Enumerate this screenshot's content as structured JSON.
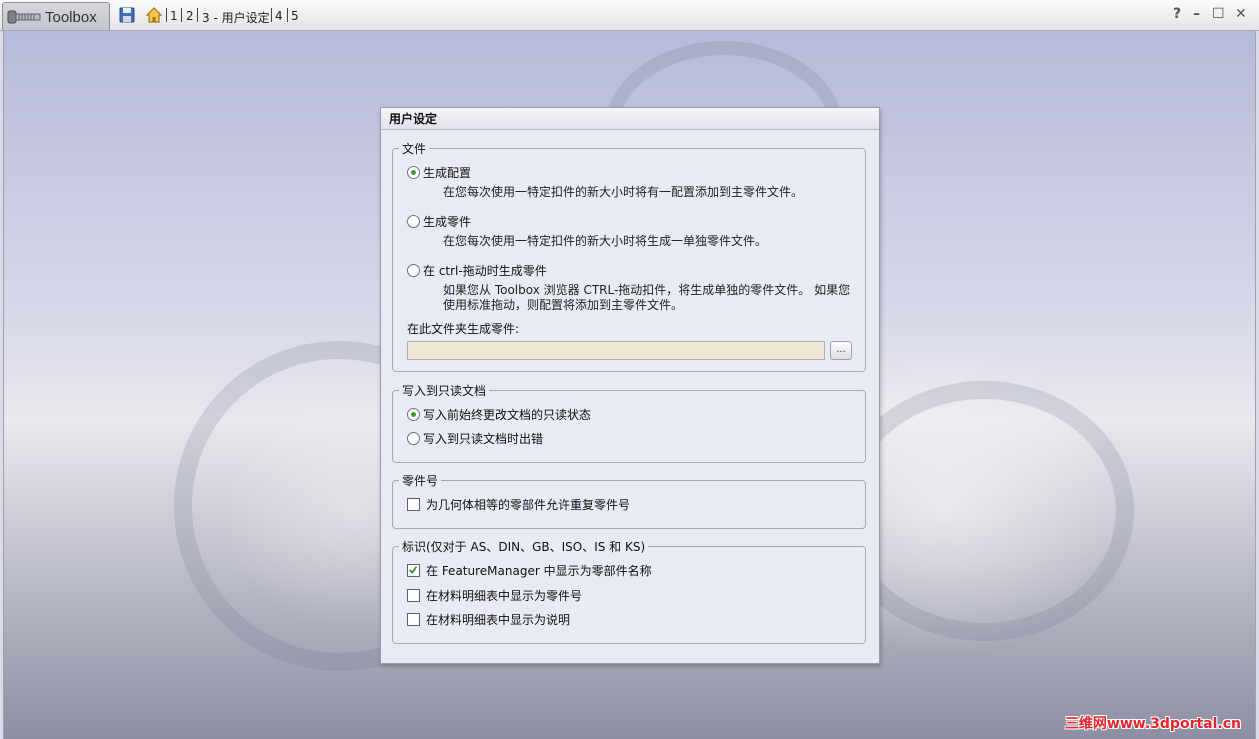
{
  "app": {
    "title": "Toolbox"
  },
  "breadcrumb": {
    "items": [
      "1",
      "2",
      "3 - 用户设定",
      "4",
      "5"
    ]
  },
  "window_controls": {
    "help": "?",
    "minimize": "–",
    "maximize": "☐",
    "close": "✕"
  },
  "dialog": {
    "title": "用户设定",
    "file_group": {
      "title": "文件",
      "options": [
        {
          "label": "生成配置",
          "selected": true,
          "desc": "在您每次使用一特定扣件的新大小时将有一配置添加到主零件文件。"
        },
        {
          "label": "生成零件",
          "selected": false,
          "desc": "在您每次使用一特定扣件的新大小时将生成一单独零件文件。"
        },
        {
          "label": "在 ctrl-拖动时生成零件",
          "selected": false,
          "desc": "如果您从 Toolbox 浏览器 CTRL-拖动扣件，将生成单独的零件文件。 如果您使用标准拖动，则配置将添加到主零件文件。"
        }
      ],
      "folder_label": "在此文件夹生成零件:",
      "folder_value": "",
      "browse_label": "..."
    },
    "readonly_group": {
      "title": "写入到只读文档",
      "options": [
        {
          "label": "写入前始终更改文档的只读状态",
          "selected": true
        },
        {
          "label": "写入到只读文档时出错",
          "selected": false
        }
      ]
    },
    "partnum_group": {
      "title": "零件号",
      "options": [
        {
          "label": "为几何体相等的零部件允许重复零件号",
          "checked": false
        }
      ]
    },
    "mark_group": {
      "title": "标识(仅对于 AS、DIN、GB、ISO、IS 和 KS)",
      "options": [
        {
          "label": "在 FeatureManager 中显示为零部件名称",
          "checked": true
        },
        {
          "label": "在材料明细表中显示为零件号",
          "checked": false
        },
        {
          "label": "在材料明细表中显示为说明",
          "checked": false
        }
      ]
    }
  },
  "watermark": {
    "text": "三维网www.3dportal.cn"
  },
  "colors": {
    "radio_dot": "#3a9b3a",
    "input_bg": "#efe9d4",
    "dialog_bg": "#e9ebf4",
    "watermark": "#e8242a"
  },
  "icons": [
    "app-logo-icon",
    "save-icon",
    "home-icon",
    "help-icon",
    "minimize-icon",
    "maximize-icon",
    "close-icon",
    "check-icon"
  ]
}
